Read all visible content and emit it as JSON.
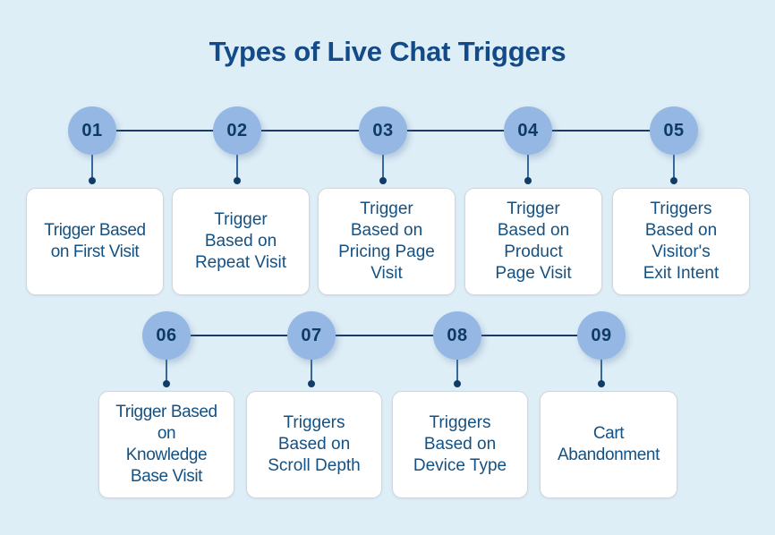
{
  "header": {
    "title": "Types of Live Chat Triggers"
  },
  "colors": {
    "background": "#deeef7",
    "title_text": "#134a87",
    "node_fill": "#95b7e4",
    "node_text": "#0e3a63",
    "connector": "#1b3a66",
    "card_background": "#ffffff",
    "card_border": "#d3d6da",
    "card_text": "#145182"
  },
  "diagram": {
    "type": "numbered-timeline",
    "rows": [
      {
        "id": "row-1",
        "nodes": [
          {
            "number": "01",
            "label": "Trigger Based\non First Visit"
          },
          {
            "number": "02",
            "label": "Trigger\nBased on\nRepeat Visit"
          },
          {
            "number": "03",
            "label": "Trigger\nBased on\nPricing Page\nVisit"
          },
          {
            "number": "04",
            "label": "Trigger\nBased on\nProduct\nPage Visit"
          },
          {
            "number": "05",
            "label": "Triggers\nBased on\nVisitor's\nExit Intent"
          }
        ]
      },
      {
        "id": "row-2",
        "nodes": [
          {
            "number": "06",
            "label": "Trigger Based\non\nKnowledge\nBase Visit"
          },
          {
            "number": "07",
            "label": "Triggers\nBased on\nScroll Depth"
          },
          {
            "number": "08",
            "label": "Triggers\nBased on\nDevice Type"
          },
          {
            "number": "09",
            "label": "Cart\nAbandonment"
          }
        ]
      }
    ]
  }
}
